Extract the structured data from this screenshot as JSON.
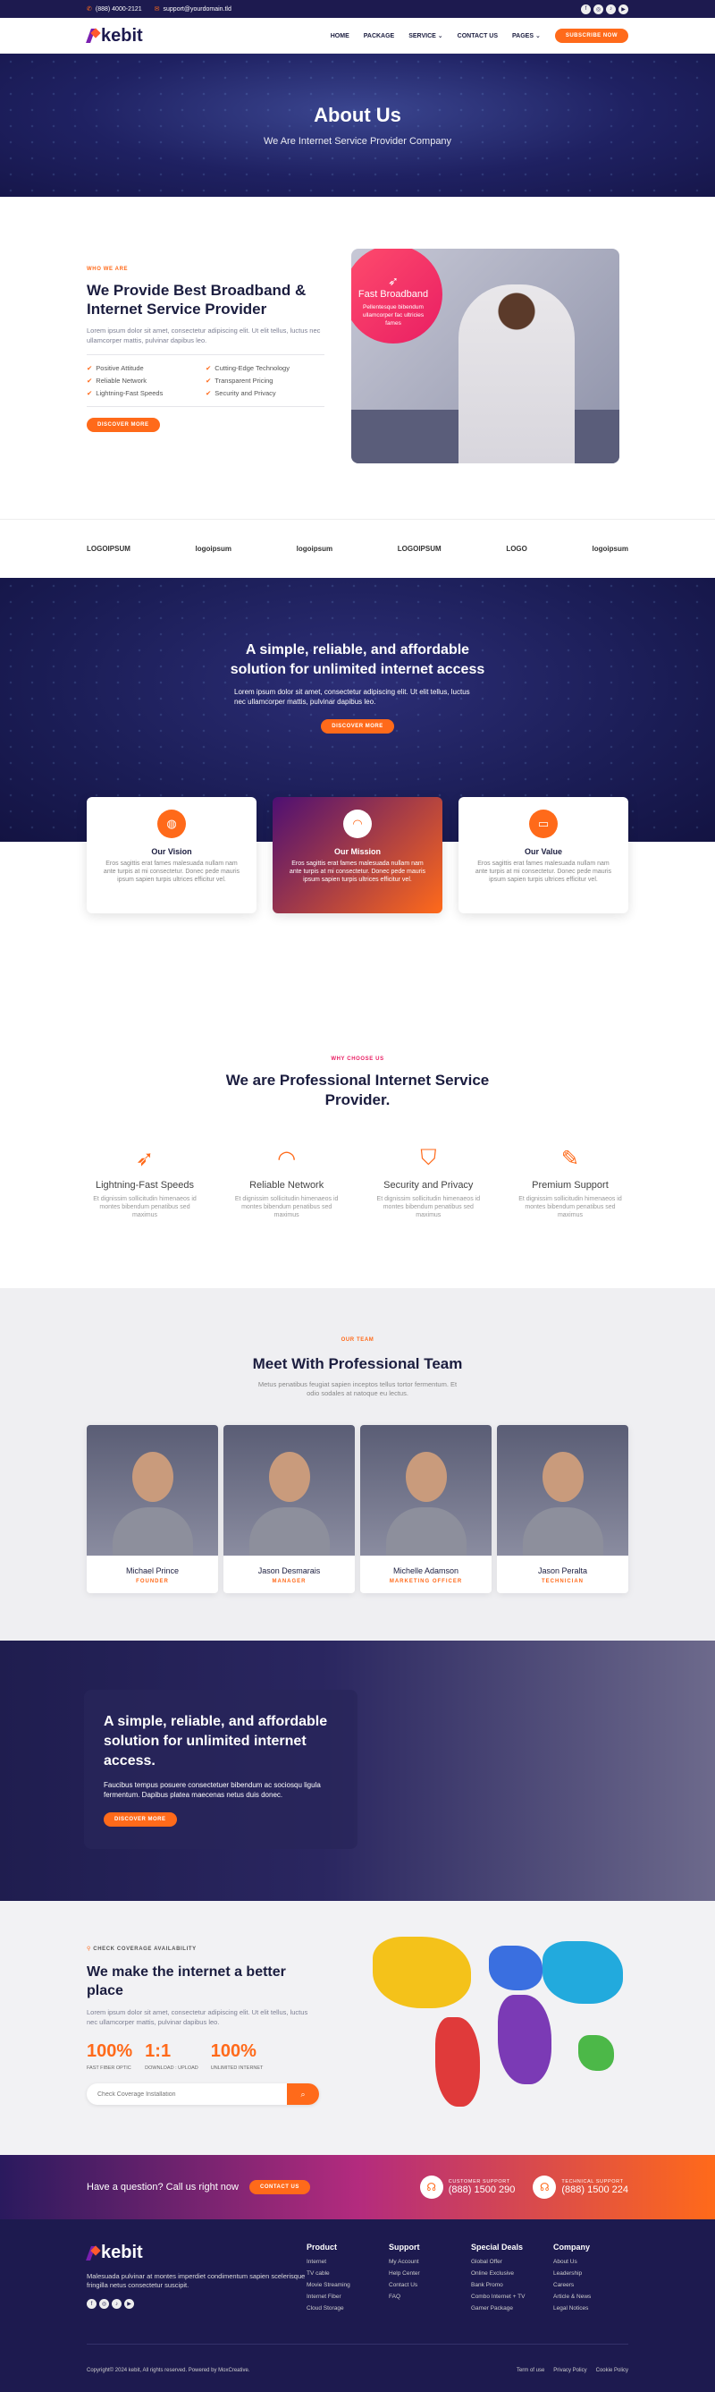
{
  "topbar": {
    "phone": "(888) 4000-2121",
    "email": "support@yourdomain.tld",
    "socials": [
      "f",
      "◎",
      "♪",
      "▶"
    ]
  },
  "nav": {
    "logo": "kebit",
    "items": [
      "HOME",
      "PACKAGE",
      "SERVICE ⌄",
      "CONTACT US",
      "PAGES ⌄"
    ],
    "cta": "SUBSCRIBE NOW"
  },
  "hero": {
    "title": "About Us",
    "subtitle": "We Are Internet Service Provider Company"
  },
  "about": {
    "eyebrow": "WHO WE ARE",
    "title": "We Provide Best Broadband & Internet Service Provider",
    "body": "Lorem ipsum dolor sit amet, consectetur adipiscing elit. Ut elit tellus, luctus nec ullamcorper mattis, pulvinar dapibus leo.",
    "features": [
      "Positive Attitude",
      "Cutting-Edge Technology",
      "Reliable Network",
      "Transparent Pricing",
      "Lightning-Fast Speeds",
      "Security and Privacy"
    ],
    "button": "DISCOVER MORE",
    "badge_title": "Fast Broadband",
    "badge_text": "Pellentesque bibendum ullamcorper fac ultricies fames"
  },
  "logos": [
    "LOGOIPSUM",
    "logoipsum",
    "logoipsum",
    "LOGOIPSUM",
    "LOGO",
    "logoipsum"
  ],
  "mission": {
    "title": "A simple, reliable, and affordable solution for unlimited internet access",
    "body": "Lorem ipsum dolor sit amet, consectetur adipiscing elit. Ut elit tellus, luctus nec ullamcorper mattis, pulvinar dapibus leo.",
    "button": "DISCOVER MORE"
  },
  "cards": [
    {
      "title": "Our Vision",
      "text": "Eros sagittis erat fames malesuada nullam nam ante turpis at mi consectetur. Donec pede mauris ipsum sapien turpis ultrices efficitur vel."
    },
    {
      "title": "Our Mission",
      "text": "Eros sagittis erat fames malesuada nullam nam ante turpis at mi consectetur. Donec pede mauris ipsum sapien turpis ultrices efficitur vel."
    },
    {
      "title": "Our Value",
      "text": "Eros sagittis erat fames malesuada nullam nam ante turpis at mi consectetur. Donec pede mauris ipsum sapien turpis ultrices efficitur vel."
    }
  ],
  "why": {
    "eyebrow": "WHY CHOOSE US",
    "title": "We are Professional Internet Service Provider.",
    "items": [
      {
        "title": "Lightning-Fast Speeds",
        "text": "Et dignissim sollicitudin himenaeos id montes bibendum penatibus sed maximus"
      },
      {
        "title": "Reliable Network",
        "text": "Et dignissim sollicitudin himenaeos id montes bibendum penatibus sed maximus"
      },
      {
        "title": "Security and Privacy",
        "text": "Et dignissim sollicitudin himenaeos id montes bibendum penatibus sed maximus"
      },
      {
        "title": "Premium Support",
        "text": "Et dignissim sollicitudin himenaeos id montes bibendum penatibus sed maximus"
      }
    ]
  },
  "team": {
    "eyebrow": "OUR TEAM",
    "title": "Meet With Professional Team",
    "sub": "Metus penatibus feugiat sapien inceptos tellus tortor fermentum. Et odio sodales at natoque eu lectus.",
    "members": [
      {
        "name": "Michael Prince",
        "role": "FOUNDER"
      },
      {
        "name": "Jason Desmarais",
        "role": "MANAGER"
      },
      {
        "name": "Michelle Adamson",
        "role": "MARKETING OFFICER"
      },
      {
        "name": "Jason Peralta",
        "role": "TECHNICIAN"
      }
    ]
  },
  "cta": {
    "title": "A simple, reliable, and affordable solution for unlimited internet access.",
    "body": "Faucibus tempus posuere consectetuer bibendum ac sociosqu ligula fermentum. Dapibus platea maecenas netus duis donec.",
    "button": "DISCOVER MORE"
  },
  "coverage": {
    "eyebrow": "CHECK COVERAGE AVAILABILITY",
    "title": "We make the internet a better place",
    "body": "Lorem ipsum dolor sit amet, consectetur adipiscing elit. Ut elit tellus, luctus nec ullamcorper mattis, pulvinar dapibus leo.",
    "stats": [
      {
        "v": "100%",
        "l": "FAST FIBER OPTIC"
      },
      {
        "v": "1:1",
        "l": "DOWNLOAD : UPLOAD"
      },
      {
        "v": "100%",
        "l": "UNLIMITED INTERNET"
      }
    ],
    "placeholder": "Check Coverage Installation"
  },
  "qbar": {
    "question": "Have a question? Call us right now",
    "button": "CONTACT US",
    "support": [
      {
        "label": "CUSTOMER SUPPORT",
        "phone": "(888) 1500 290"
      },
      {
        "label": "TECHNICAL SUPPORT",
        "phone": "(888) 1500 224"
      }
    ]
  },
  "footer": {
    "logo": "kebit",
    "text": "Malesuada pulvinar at montes imperdiet condimentum sapien scelerisque fringilla netus consectetur suscipit.",
    "cols": [
      {
        "title": "Product",
        "links": [
          "Internet",
          "TV cable",
          "Movie Streaming",
          "Internet Fiber",
          "Cloud Storage"
        ]
      },
      {
        "title": "Support",
        "links": [
          "My Account",
          "Help Center",
          "Contact Us",
          "FAQ"
        ]
      },
      {
        "title": "Special Deals",
        "links": [
          "Global Offer",
          "Online Exclusive",
          "Bank Promo",
          "Combo Internet + TV",
          "Gamer Package"
        ]
      },
      {
        "title": "Company",
        "links": [
          "About Us",
          "Leadership",
          "Careers",
          "Article & News",
          "Legal Notices"
        ]
      }
    ],
    "copyright": "Copyright© 2024 kebit, All rights reserved. Powered by MoxCreative.",
    "legal": [
      "Term of use",
      "Privacy Policy",
      "Cookie Policy"
    ]
  },
  "colors": {
    "accent": "#ff6a1a",
    "navy": "#1d1a4f",
    "pink": "#e91e63"
  }
}
